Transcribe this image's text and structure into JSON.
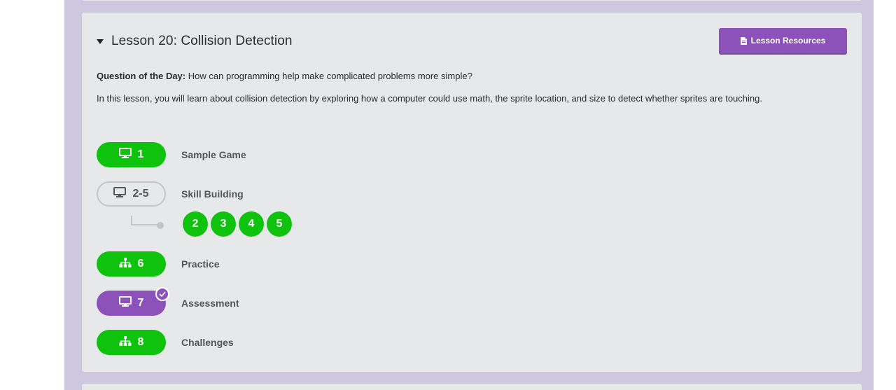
{
  "lesson": {
    "title": "Lesson 20: Collision Detection",
    "resources_label": "Lesson Resources",
    "qotd_label": "Question of the Day:",
    "qotd_text": "How can programming help make complicated problems more simple?",
    "description": "In this lesson, you will learn about collision detection by exploring how a computer could use math, the sprite location, and size to detect whether sprites are touching."
  },
  "levels": [
    {
      "num": "1",
      "name": "Sample Game",
      "icon": "desktop-icon",
      "style": "green"
    },
    {
      "num": "2-5",
      "name": "Skill Building",
      "icon": "desktop-icon",
      "style": "outline"
    },
    {
      "num": "6",
      "name": "Practice",
      "icon": "sitemap-icon",
      "style": "green"
    },
    {
      "num": "7",
      "name": "Assessment",
      "icon": "desktop-icon",
      "style": "purple"
    },
    {
      "num": "8",
      "name": "Challenges",
      "icon": "sitemap-icon",
      "style": "green"
    }
  ],
  "sublevels": [
    "2",
    "3",
    "4",
    "5"
  ],
  "colors": {
    "green": "#0ec20e",
    "purple": "#8c52ba",
    "page_bg": "#cdc8df",
    "card_bg": "#e7e8ea"
  }
}
